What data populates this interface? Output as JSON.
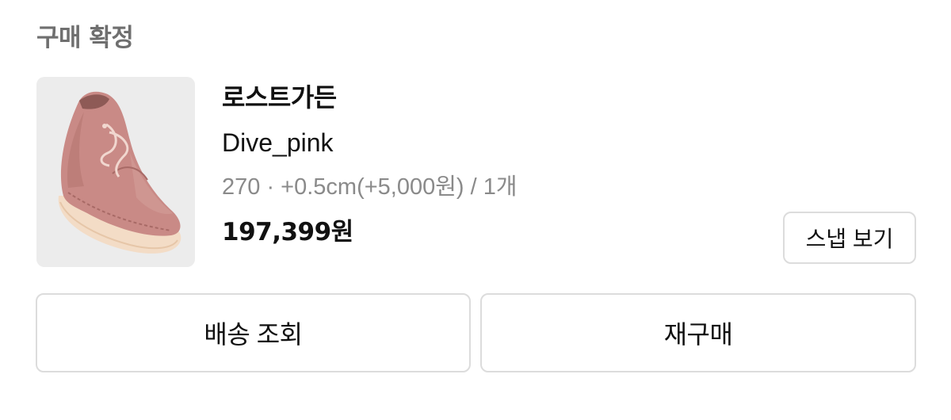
{
  "order": {
    "status_label": "구매 확정",
    "brand": "로스트가든",
    "product_name": "Dive_pink",
    "option_text": "270 · +0.5cm(+5,000원) / 1개",
    "price": "197,399원"
  },
  "buttons": {
    "snap_label": "스냅 보기",
    "delivery_label": "배송 조회",
    "rebuy_label": "재구매"
  },
  "thumbnail": {
    "icon": "pink-suede-shoe-image",
    "background": "#ececec",
    "shoe_color": "#c98a86"
  }
}
